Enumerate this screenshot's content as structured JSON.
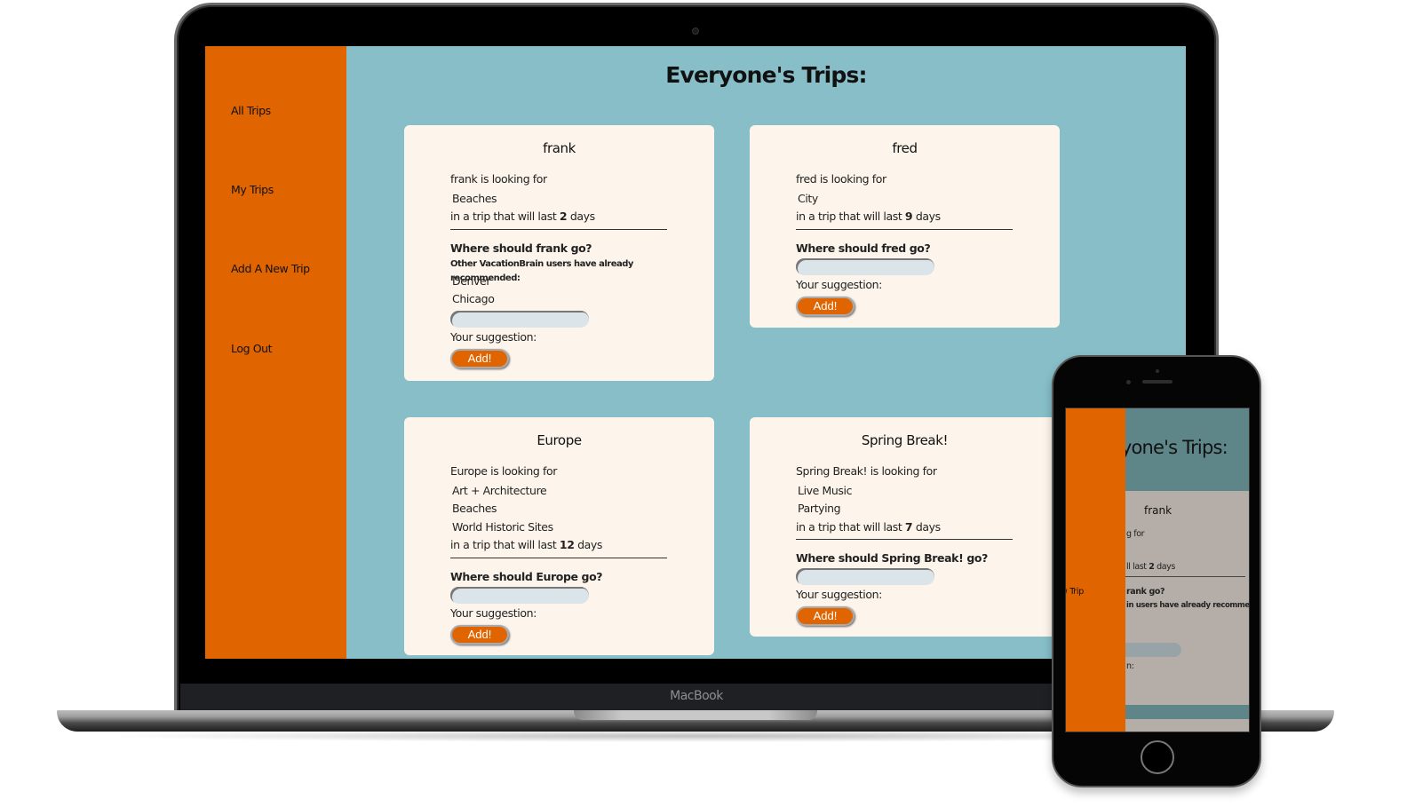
{
  "laptop": {
    "brand_label": "MacBook"
  },
  "app": {
    "page_title": "Everyone's Trips:",
    "sidebar": {
      "items": [
        {
          "label": "All Trips"
        },
        {
          "label": "My Trips"
        },
        {
          "label": "Add A New Trip"
        },
        {
          "label": "Log Out"
        }
      ]
    },
    "colors": {
      "sidebar": "#e06400",
      "main_bg": "#87bec8",
      "card_bg": "#fdf5ec",
      "button": "#e06400"
    },
    "trips": [
      {
        "name": "frank",
        "looking_for": "frank is looking for",
        "interests": [
          "Beaches"
        ],
        "duration_prefix": "in a trip that will last",
        "days": "2",
        "duration_suffix": "days",
        "where_prompt": "Where should frank go?",
        "recommended_label": "Other VacationBrain users have already recommended:",
        "recommendations": [
          "Denver",
          "Chicago"
        ],
        "suggestion_value": "",
        "suggestion_label": "Your suggestion:",
        "add_label": "Add!"
      },
      {
        "name": "fred",
        "looking_for": "fred is looking for",
        "interests": [
          "City"
        ],
        "duration_prefix": "in a trip that will last",
        "days": "9",
        "duration_suffix": "days",
        "where_prompt": "Where should fred go?",
        "suggestion_value": "",
        "suggestion_label": "Your suggestion:",
        "add_label": "Add!"
      },
      {
        "name": "Europe",
        "looking_for": "Europe is looking for",
        "interests": [
          "Art + Architecture",
          "Beaches",
          "World Historic Sites"
        ],
        "duration_prefix": "in a trip that will last",
        "days": "12",
        "duration_suffix": "days",
        "where_prompt": "Where should Europe go?",
        "suggestion_value": "",
        "suggestion_label": "Your suggestion:",
        "add_label": "Add!"
      },
      {
        "name": "Spring Break!",
        "looking_for": "Spring Break! is looking for",
        "interests": [
          "Live Music",
          "Partying"
        ],
        "duration_prefix": "in a trip that will last",
        "days": "7",
        "duration_suffix": "days",
        "where_prompt": "Where should Spring Break! go?",
        "suggestion_value": "",
        "suggestion_label": "Your suggestion:",
        "add_label": "Add!"
      }
    ]
  },
  "phone": {
    "title_fragment": "ryone's Trips:",
    "card_title": "frank",
    "looking_fragment": "g for",
    "duration_fragment_prefix": "ll last",
    "days": "2",
    "duration_suffix": "days",
    "where_fragment": "rank go?",
    "recommended_fragment": "in users have already recommended:",
    "suggestion_fragment": "n:",
    "nav_fragment": "w Trip"
  }
}
